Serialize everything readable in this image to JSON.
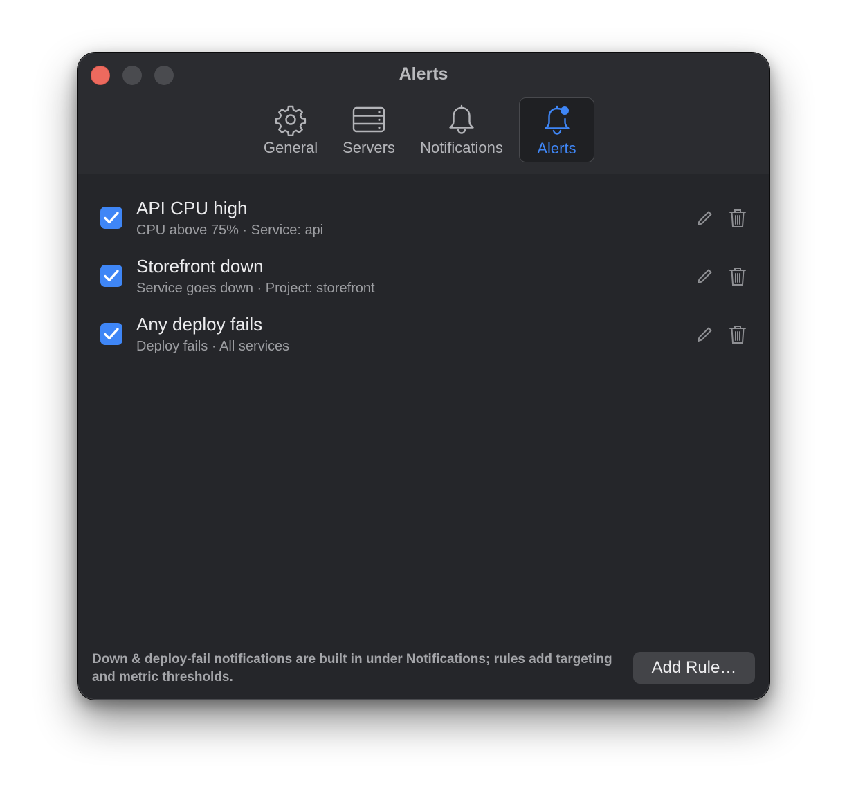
{
  "window": {
    "title": "Alerts"
  },
  "tabs": [
    {
      "label": "General",
      "icon": "gear-icon"
    },
    {
      "label": "Servers",
      "icon": "server-icon"
    },
    {
      "label": "Notifications",
      "icon": "bell-icon"
    },
    {
      "label": "Alerts",
      "icon": "bell-badge-icon",
      "active": true
    }
  ],
  "rules": [
    {
      "title": "API CPU high",
      "subtitle": "CPU above 75% · Service: api",
      "enabled": true
    },
    {
      "title": "Storefront down",
      "subtitle": "Service goes down · Project: storefront",
      "enabled": true
    },
    {
      "title": "Any deploy fails",
      "subtitle": "Deploy fails · All services",
      "enabled": true
    }
  ],
  "footer": {
    "note": "Down & deploy-fail notifications are built in under Notifications; rules add targeting and metric thresholds.",
    "add_button": "Add Rule…"
  },
  "colors": {
    "accent": "#3f86f6",
    "window_bg": "#25262a",
    "close_button": "#ed6a5e"
  }
}
